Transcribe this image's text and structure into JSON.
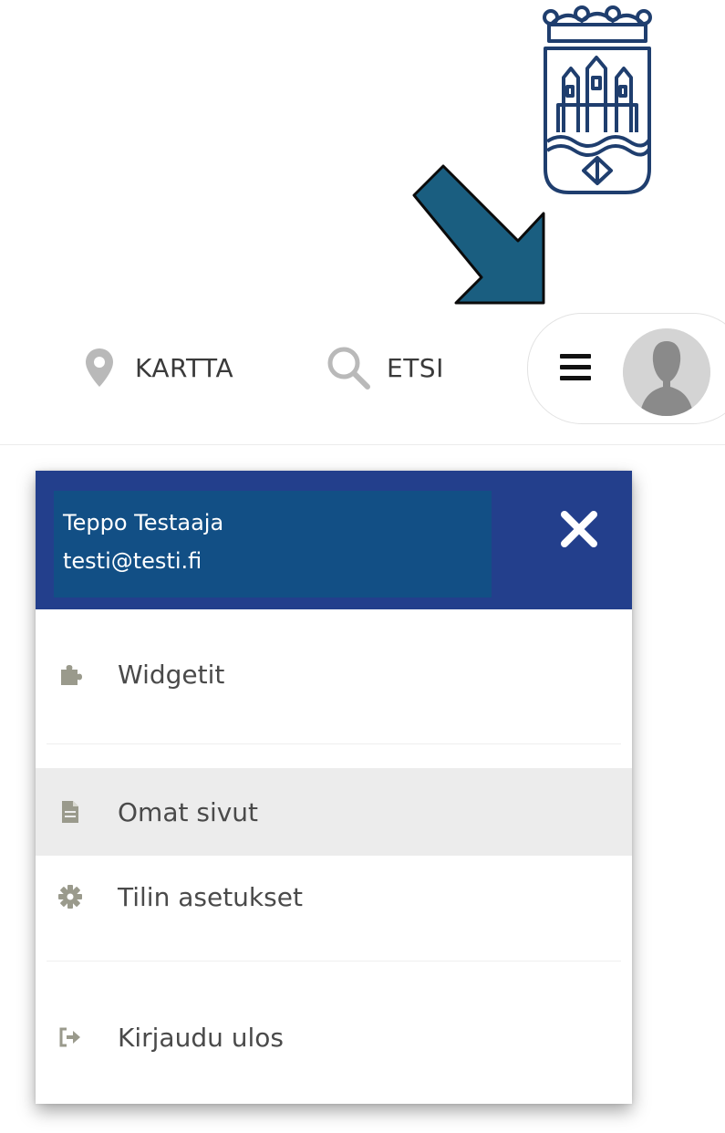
{
  "nav": {
    "map_label": "KARTTA",
    "map_icon": "map-pin-icon",
    "search_label": "ETSI",
    "search_icon": "search-icon",
    "menu_icon": "hamburger-icon",
    "avatar_icon": "user-avatar-icon"
  },
  "user_menu": {
    "user_name": "Teppo Testaaja",
    "user_email": "testi@testi.fi",
    "close_icon": "close-icon",
    "items": [
      {
        "label": "Widgetit",
        "icon": "puzzle-piece-icon"
      },
      {
        "label": "Omat sivut",
        "icon": "file-icon",
        "highlighted": true
      },
      {
        "label": "Tilin asetukset",
        "icon": "gear-icon"
      },
      {
        "label": "Kirjaudu ulos",
        "icon": "sign-out-icon"
      }
    ]
  },
  "colors": {
    "menu_header": "#233f8c",
    "user_box": "#124f85",
    "annotation_arrow": "#1a5e80",
    "crest": "#1f3e6e",
    "icon_gray": "#9a9a8c"
  },
  "logo_icon": "city-crest-logo"
}
